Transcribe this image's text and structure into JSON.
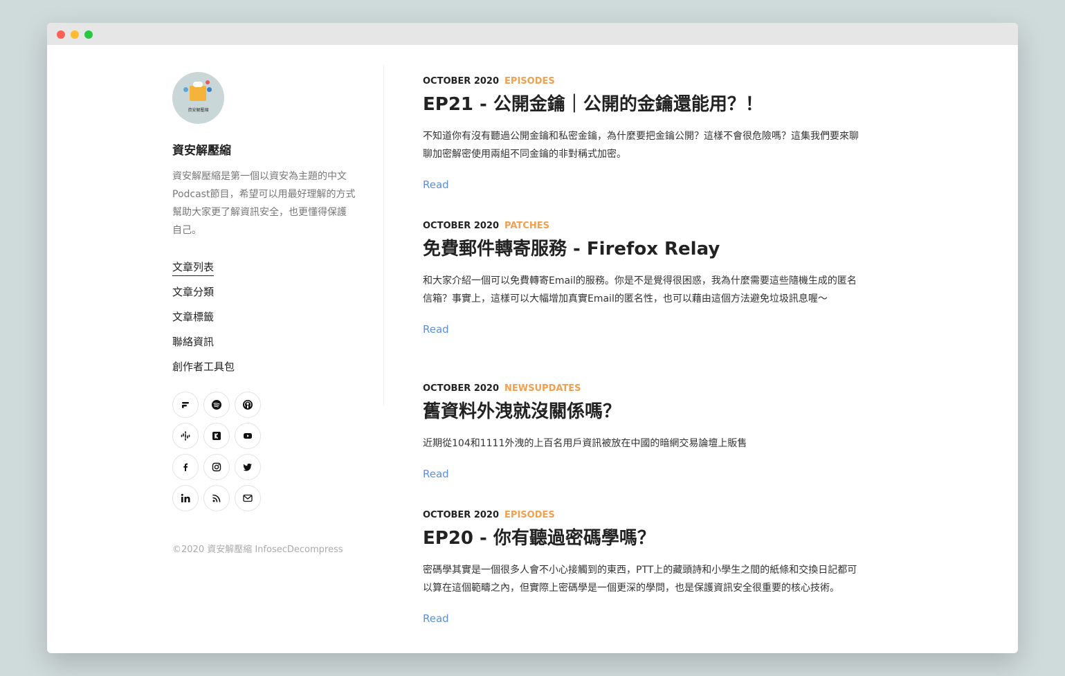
{
  "sidebar": {
    "avatar_caption": "資安解壓縮",
    "site_title": "資安解壓縮",
    "site_desc": "資安解壓縮是第一個以資安為主題的中文Podcast節目，希望可以用最好理解的方式幫助大家更了解資訊安全，也更懂得保護自己。",
    "nav": [
      {
        "label": "文章列表"
      },
      {
        "label": "文章分類"
      },
      {
        "label": "文章標籤"
      },
      {
        "label": "聯絡資訊"
      },
      {
        "label": "創作者工具包"
      }
    ],
    "social_icons": [
      "firstory-icon",
      "spotify-icon",
      "apple-podcasts-icon",
      "google-podcasts-icon",
      "kkbox-icon",
      "youtube-icon",
      "facebook-icon",
      "instagram-icon",
      "twitter-icon",
      "linkedin-icon",
      "rss-icon",
      "email-icon"
    ],
    "copyright": "©2020 資安解壓縮 InfosecDecompress"
  },
  "posts": [
    {
      "date": "OCTOBER 2020",
      "category": "EPISODES",
      "title": "EP21 - 公開金鑰｜公開的金鑰還能用？！",
      "excerpt": "不知道你有沒有聽過公開金鑰和私密金鑰，為什麼要把金鑰公開？這樣不會很危險嗎？這集我們要來聊聊加密解密使用兩組不同金鑰的非對稱式加密。",
      "read": "Read"
    },
    {
      "date": "OCTOBER 2020",
      "category": "PATCHES",
      "title": "免費郵件轉寄服務 - Firefox Relay",
      "excerpt": "和大家介紹一個可以免費轉寄Email的服務。你是不是覺得很困惑，我為什麼需要這些隨機生成的匿名信箱？事實上，這樣可以大幅增加真實Email的匿名性，也可以藉由這個方法避免垃圾訊息喔～",
      "read": "Read"
    },
    {
      "date": "OCTOBER 2020",
      "category": "NEWSUPDATES",
      "title": "舊資料外洩就沒關係嗎？",
      "excerpt": "近期從104和1111外洩的上百名用戶資訊被放在中國的暗網交易論壇上販售",
      "read": "Read"
    },
    {
      "date": "OCTOBER 2020",
      "category": "EPISODES",
      "title": "EP20 - 你有聽過密碼學嗎？",
      "excerpt": "密碼學其實是一個很多人會不小心接觸到的東西，PTT上的藏頭詩和小學生之間的紙條和交換日記都可以算在這個範疇之內，但實際上密碼學是一個更深的學問，也是保護資訊安全很重要的核心技術。",
      "read": "Read"
    }
  ],
  "colors": {
    "category": "#f0a050",
    "link": "#5b8fd9",
    "background": "#cfdadb"
  }
}
